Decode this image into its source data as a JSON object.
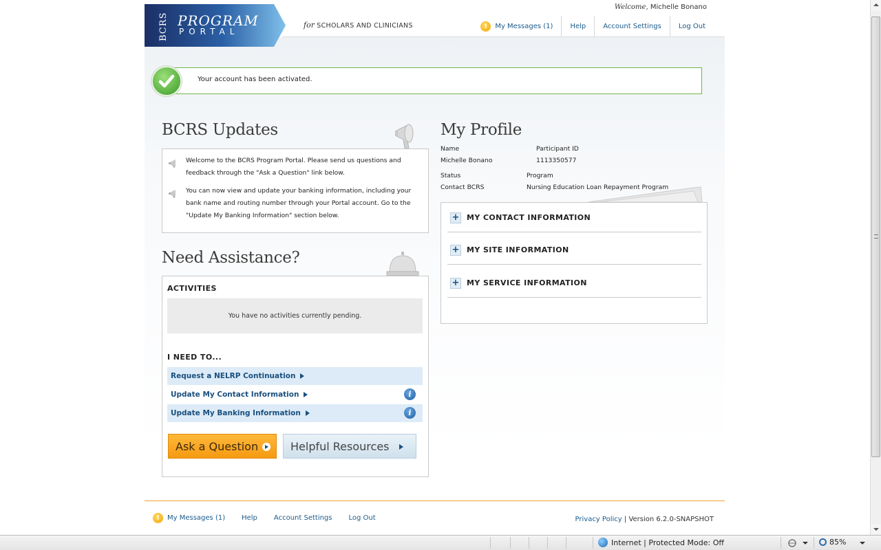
{
  "header": {
    "logo": {
      "brand": "BCRS",
      "line1": "PROGRAM",
      "line2": "PORTAL"
    },
    "tagline_prefix": "for",
    "tagline": "SCHOLARS AND CLINICIANS",
    "welcome_prefix": "Welcome,",
    "welcome_user": "Michelle Bonano",
    "nav": {
      "messages": "My Messages (1)",
      "help": "Help",
      "account_settings": "Account Settings",
      "logout": "Log Out"
    }
  },
  "notice": {
    "text": "Your account has been activated."
  },
  "updates": {
    "title": "BCRS Updates",
    "items": [
      "Welcome to the BCRS Program Portal. Please send us questions and feedback through the \"Ask a Question\" link below.",
      "You can now view and update your banking information, including your bank name and routing number through your Portal account. Go to the \"Update My Banking Information\" section below."
    ]
  },
  "assistance": {
    "title": "Need Assistance?",
    "activities_heading": "ACTIVITIES",
    "pending_text": "You have no activities currently pending.",
    "need_heading": "I NEED TO...",
    "actions": [
      "Request a NELRP Continuation",
      "Update My Contact Information",
      "Update My Banking Information"
    ],
    "ask_button": "Ask a Question",
    "resources_button": "Helpful Resources"
  },
  "profile": {
    "title": "My Profile",
    "name_label": "Name",
    "name_value": "Michelle Bonano",
    "participant_label": "Participant ID",
    "participant_value": "1113350577",
    "status_label": "Status",
    "contact_label": "Contact BCRS",
    "program_label": "Program",
    "program_value": "Nursing Education Loan Repayment Program",
    "sections": [
      "MY CONTACT INFORMATION",
      "MY SITE INFORMATION",
      "MY SERVICE INFORMATION"
    ]
  },
  "footer": {
    "messages": "My Messages (1)",
    "help": "Help",
    "account_settings": "Account Settings",
    "logout": "Log Out",
    "privacy": "Privacy Policy",
    "version": "| Version 6.2.0-SNAPSHOT"
  },
  "statusbar": {
    "zone": "Internet | Protected Mode: Off",
    "zoom": "85%"
  },
  "colors": {
    "link": "#1a5a8a",
    "accent_orange": "#f59a12",
    "success_green": "#6fb448",
    "logo_blue": "#1d3f7a"
  }
}
